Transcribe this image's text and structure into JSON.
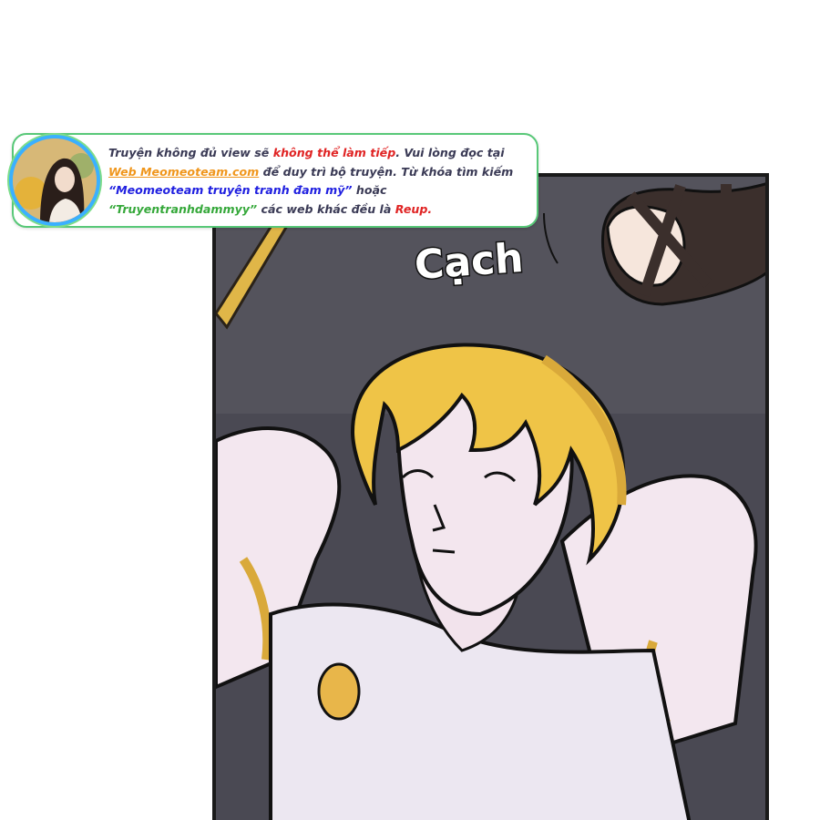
{
  "sfx": "Cạch",
  "banner": {
    "line1_a": "Truyện không đủ view sẽ ",
    "line1_b": "không thể làm tiếp",
    "line1_c": ". Vui lòng đọc tại",
    "line2_a": "Web Meomeoteam.com",
    "line2_b": " để duy trì bộ truyện. Từ khóa tìm kiếm",
    "line3_a": "“Meomeoteam truyện tranh đam mỹ”",
    "line3_b": " hoặc",
    "line4_a": "“Truyentranhdammyy”",
    "line4_b": " các web khác đều là ",
    "line4_c": "Reup."
  },
  "colors": {
    "banner_border": "#58c878",
    "avatar_ring": "#3ab0ff",
    "highlight_red": "#e02424",
    "highlight_orange": "#f0961c",
    "highlight_blue": "#2020e0",
    "highlight_green": "#35a83a"
  }
}
